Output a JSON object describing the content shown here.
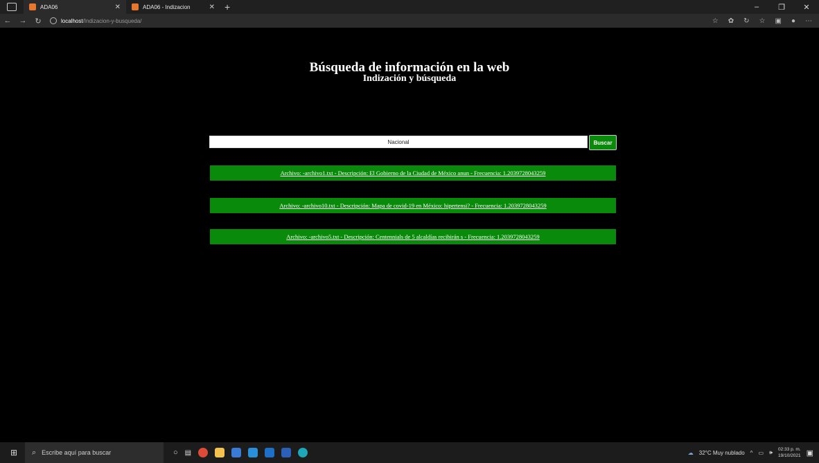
{
  "browser": {
    "tabs": [
      {
        "title": "ADA06"
      },
      {
        "title": "ADA06 - Indizacion"
      }
    ],
    "url_host": "localhost",
    "url_path": "/Indizacion-y-busqueda/"
  },
  "page": {
    "title": "Búsqueda de información en la web",
    "subtitle": "Indización y búsqueda",
    "search": {
      "value": "Nacional",
      "button_label": "Buscar"
    },
    "results": [
      {
        "text": "Archivo: -archivo1.txt - Descripción: El Gobierno de la Ciudad de México anun - Frecuencia: 1.2039728043259"
      },
      {
        "text": "Archivo: -archivo10.txt - Descripción: Mapa de covid-19 en México: hipertensi? - Frecuencia: 1.2039728043259"
      },
      {
        "text": "Archivo: -archivo5.txt - Descripción: Centennials de 5 alcaldías recibirán s - Frecuencia: 1.2039728043259"
      }
    ]
  },
  "taskbar": {
    "search_placeholder": "Escribe aquí para buscar",
    "weather": "32°C  Muy nublado",
    "time": "02:33 p. m.",
    "date": "19/10/2021"
  },
  "colors": {
    "accent_green": "#0a8a0a",
    "background": "#000000",
    "tab_favicon": "#e8772e"
  }
}
